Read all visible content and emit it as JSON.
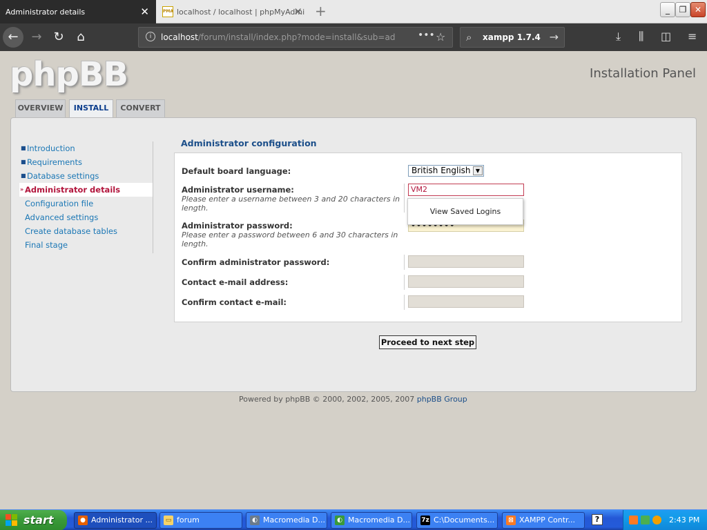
{
  "browser": {
    "tabs": [
      {
        "title": "Administrator details",
        "active": true
      },
      {
        "title": "localhost / localhost | phpMyAdmi",
        "favicon": "PMA",
        "active": false
      }
    ],
    "url": {
      "host": "localhost",
      "path": "/forum/install/index.php?mode=install&sub=adm"
    },
    "search": {
      "query": "xampp 1.7.4"
    }
  },
  "page": {
    "logo": "phpBB",
    "panel_title": "Installation Panel",
    "tabs": [
      {
        "label": "OVERVIEW",
        "active": false
      },
      {
        "label": "INSTALL",
        "active": true
      },
      {
        "label": "CONVERT",
        "active": false
      }
    ],
    "menu": [
      {
        "label": "Introduction",
        "state": "done"
      },
      {
        "label": "Requirements",
        "state": "done"
      },
      {
        "label": "Database settings",
        "state": "done"
      },
      {
        "label": "Administrator details",
        "state": "current"
      },
      {
        "label": "Configuration file",
        "state": "todo"
      },
      {
        "label": "Advanced settings",
        "state": "todo"
      },
      {
        "label": "Create database tables",
        "state": "todo"
      },
      {
        "label": "Final stage",
        "state": "todo"
      }
    ],
    "section_title": "Administrator configuration",
    "form": {
      "language_label": "Default board language:",
      "language_value": "British English",
      "username_label": "Administrator username:",
      "username_help": "Please enter a username between 3 and 20 characters in length.",
      "username_value": "VM2",
      "password_label": "Administrator password:",
      "password_help": "Please enter a password between 6 and 30 characters in length.",
      "password_value": "••••••••",
      "confirm_password_label": "Confirm administrator password:",
      "email_label": "Contact e-mail address:",
      "confirm_email_label": "Confirm contact e-mail:"
    },
    "autocomplete_popup": "View Saved Logins",
    "proceed_button": "Proceed to next step",
    "footer": {
      "text": "Powered by phpBB © 2000, 2002, 2005, 2007",
      "link": "phpBB Group"
    }
  },
  "taskbar": {
    "start": "start",
    "tasks": [
      {
        "label": "Administrator ...",
        "icon": "firefox-icon",
        "active": true
      },
      {
        "label": "forum",
        "icon": "folder-icon",
        "active": false
      },
      {
        "label": "Macromedia D...",
        "icon": "dreamweaver-icon",
        "active": false
      },
      {
        "label": "Macromedia D...",
        "icon": "dreamweaver-green-icon",
        "active": false
      },
      {
        "label": "C:\\Documents...",
        "icon": "7zip-icon",
        "active": false
      },
      {
        "label": "XAMPP Contr...",
        "icon": "xampp-icon",
        "active": false
      }
    ],
    "clock": "2:43 PM"
  }
}
